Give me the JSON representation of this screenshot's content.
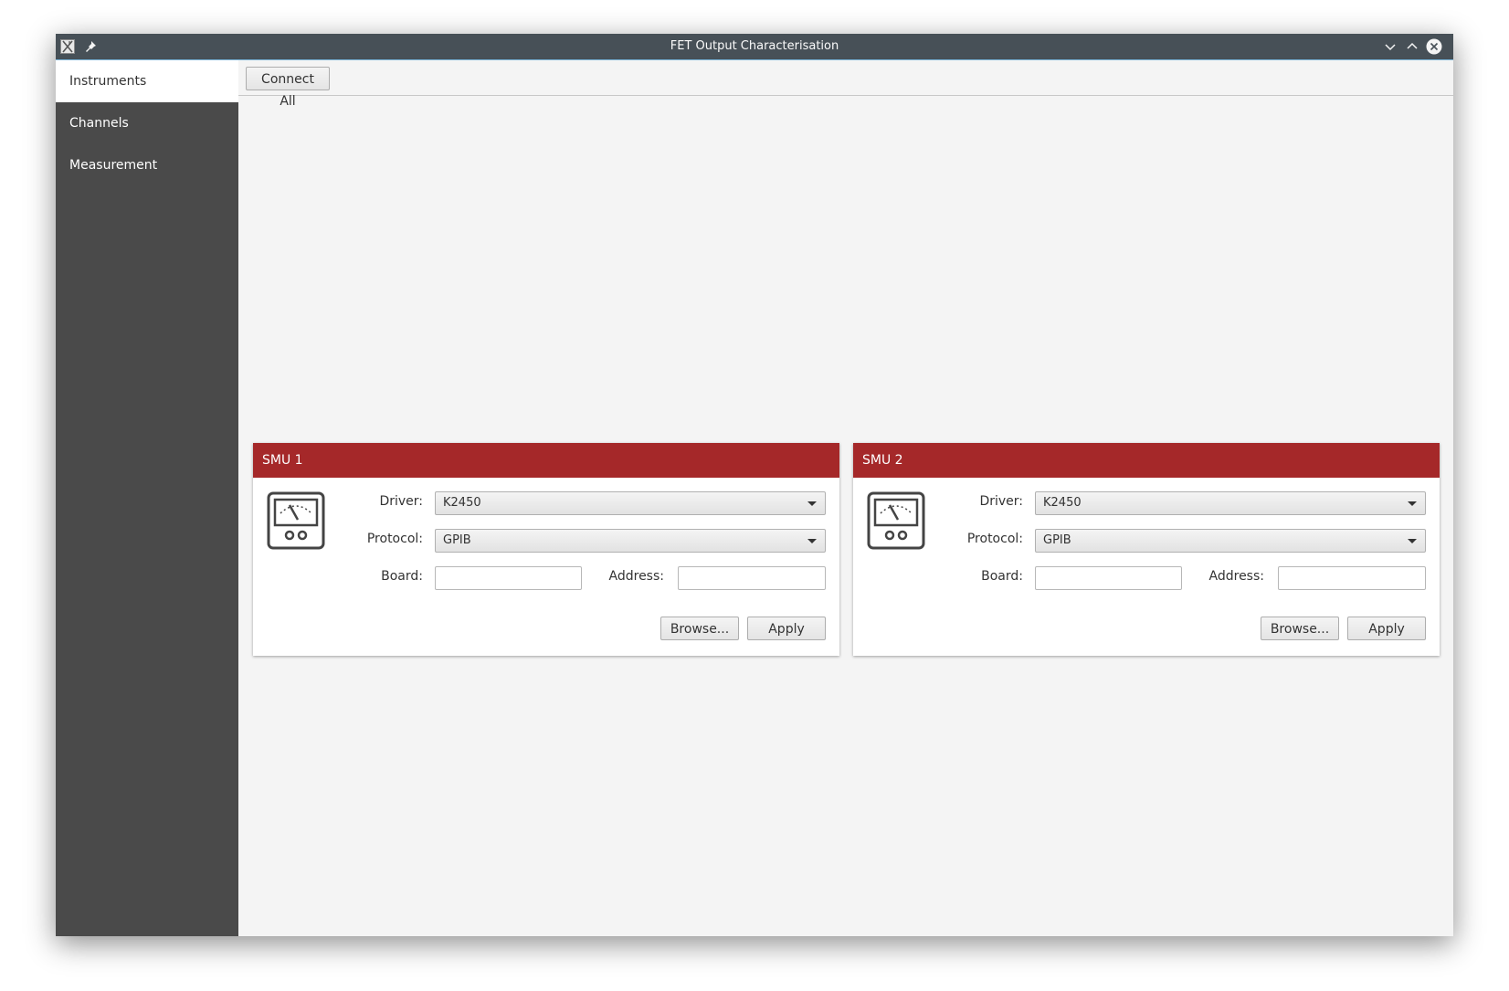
{
  "window": {
    "title": "FET Output Characterisation"
  },
  "sidebar": {
    "items": [
      {
        "label": "Instruments",
        "active": true
      },
      {
        "label": "Channels",
        "active": false
      },
      {
        "label": "Measurement",
        "active": false
      }
    ]
  },
  "toolbar": {
    "connect_all_label": "Connect All"
  },
  "panels": [
    {
      "title": "SMU 1",
      "icon": "meter-icon",
      "driver_label": "Driver:",
      "driver_value": "K2450",
      "protocol_label": "Protocol:",
      "protocol_value": "GPIB",
      "board_label": "Board:",
      "board_value": "",
      "address_label": "Address:",
      "address_value": "",
      "browse_label": "Browse...",
      "apply_label": "Apply"
    },
    {
      "title": "SMU 2",
      "icon": "meter-icon",
      "driver_label": "Driver:",
      "driver_value": "K2450",
      "protocol_label": "Protocol:",
      "protocol_value": "GPIB",
      "board_label": "Board:",
      "board_value": "",
      "address_label": "Address:",
      "address_value": "",
      "browse_label": "Browse...",
      "apply_label": "Apply"
    }
  ],
  "colors": {
    "titlebar": "#475057",
    "sidebar": "#4a4a4a",
    "panel_header": "#a52829",
    "background": "#f4f4f4"
  }
}
